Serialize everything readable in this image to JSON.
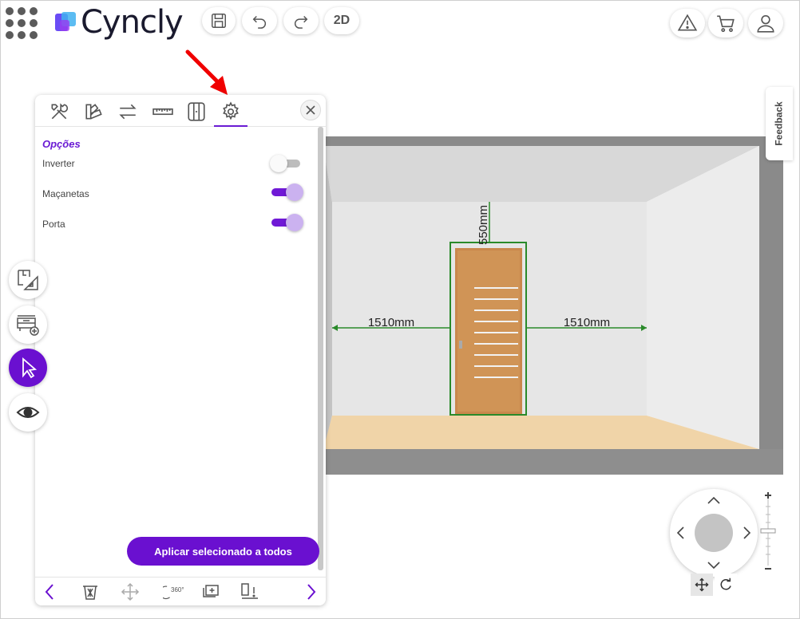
{
  "app": {
    "logo_text": "Cyncly"
  },
  "header": {
    "icons": [
      "apps-grid-icon",
      "save-icon",
      "undo-icon",
      "redo-icon"
    ],
    "view_toggle_label": "2D",
    "right_icons": [
      "warning-icon",
      "cart-icon",
      "user-icon"
    ]
  },
  "feedback": {
    "label": "Feedback"
  },
  "panel": {
    "tabs": [
      {
        "icon": "tools-icon"
      },
      {
        "icon": "color-palette-icon"
      },
      {
        "icon": "swap-icon"
      },
      {
        "icon": "ruler-icon"
      },
      {
        "icon": "door-frame-icon"
      },
      {
        "icon": "gear-icon",
        "active": true
      }
    ],
    "section_title": "Opções",
    "options": [
      {
        "label": "Inverter",
        "checked": false
      },
      {
        "label": "Maçanetas",
        "checked": true
      },
      {
        "label": "Porta",
        "checked": true
      }
    ],
    "apply_label": "Aplicar selecionado a todos",
    "footer_icons": [
      "prev-icon",
      "trash-icon",
      "move-icon",
      "rotate-360-icon",
      "duplicate-icon",
      "align-icon",
      "next-icon"
    ],
    "rotate_label": "360°"
  },
  "rail": [
    {
      "icon": "floorplan-icon",
      "active": false
    },
    {
      "icon": "add-furniture-icon",
      "active": false
    },
    {
      "icon": "cursor-icon",
      "active": true
    },
    {
      "icon": "eye-icon",
      "active": false
    }
  ],
  "scene": {
    "dim_left": "1510mm",
    "dim_right": "1510mm",
    "dim_top": "550mm"
  },
  "colors": {
    "accent": "#6a10d0",
    "dimension": "#2a8a2a"
  }
}
